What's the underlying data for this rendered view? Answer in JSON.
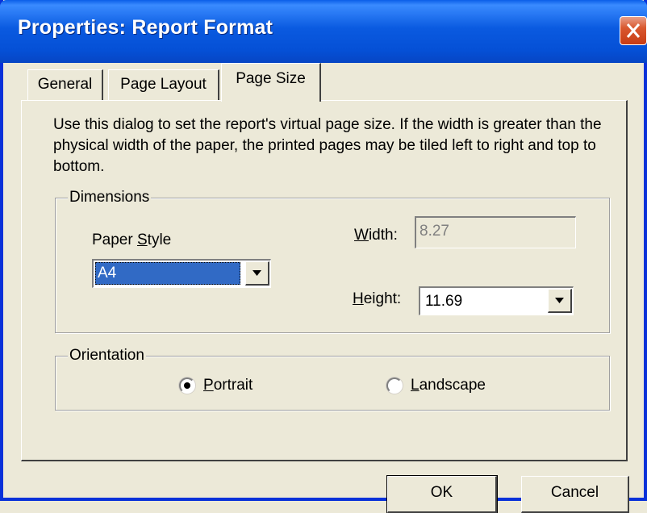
{
  "window": {
    "title": "Properties: Report Format"
  },
  "tabs": [
    {
      "label": "General",
      "active": false
    },
    {
      "label": "Page Layout",
      "active": false
    },
    {
      "label": "Page Size",
      "active": true
    }
  ],
  "description": "Use this dialog to set the report's virtual page size. If the width is greater than the physical width of the paper, the printed pages may be tiled left to right and top to bottom.",
  "dimensions": {
    "group_label": "Dimensions",
    "paper_style": {
      "label_prefix": "Paper ",
      "label_mnemonic": "S",
      "label_suffix": "tyle",
      "value": "A4"
    },
    "width": {
      "label_mnemonic": "W",
      "label_suffix": "idth:",
      "value": "8.27",
      "disabled": true
    },
    "height": {
      "label_mnemonic": "H",
      "label_suffix": "eight:",
      "value": "11.69"
    }
  },
  "orientation": {
    "group_label": "Orientation",
    "portrait": {
      "label_mnemonic": "P",
      "label_suffix": "ortrait",
      "selected": true
    },
    "landscape": {
      "label_mnemonic": "L",
      "label_suffix": "andscape",
      "selected": false
    }
  },
  "buttons": {
    "ok": "OK",
    "cancel": "Cancel"
  },
  "colors": {
    "title_bar": "#0a5ae0",
    "selection": "#316ac5",
    "close_button": "#d9582f",
    "dialog_bg": "#ece9d8"
  }
}
